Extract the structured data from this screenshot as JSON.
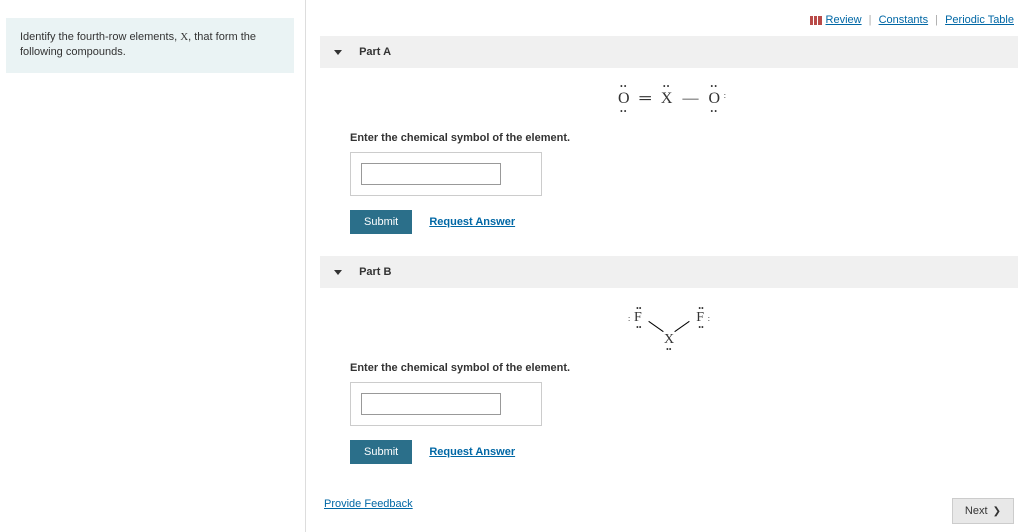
{
  "prompt": {
    "text_before": "Identify the fourth-row elements, ",
    "variable": "X",
    "text_after": ", that form the following compounds."
  },
  "top_links": {
    "review": "Review",
    "constants": "Constants",
    "periodic_table": "Periodic Table"
  },
  "parts": {
    "a": {
      "title": "Part A",
      "structure": {
        "atoms": [
          "O",
          "X",
          "O"
        ],
        "bonds": [
          "double",
          "single"
        ],
        "description": "O double-bond X single-bond O with lone pairs"
      },
      "instruction": "Enter the chemical symbol of the element.",
      "input_value": "",
      "submit_label": "Submit",
      "request_label": "Request Answer"
    },
    "b": {
      "title": "Part B",
      "structure": {
        "atoms": [
          "F",
          "X",
          "F"
        ],
        "geometry": "bent",
        "description": "bent F-X-F with lone pairs"
      },
      "instruction": "Enter the chemical symbol of the element.",
      "input_value": "",
      "submit_label": "Submit",
      "request_label": "Request Answer"
    }
  },
  "bottom": {
    "feedback": "Provide Feedback",
    "next": "Next"
  }
}
